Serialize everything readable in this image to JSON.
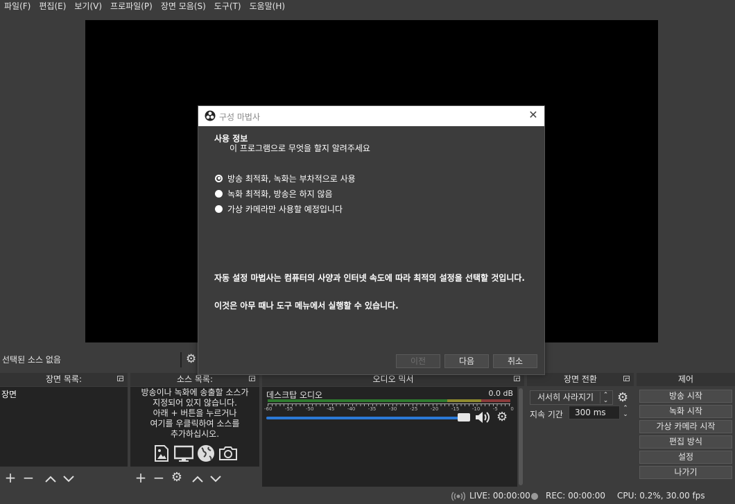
{
  "menubar": {
    "items": [
      "파일(F)",
      "편집(E)",
      "보기(V)",
      "프로파일(P)",
      "장면 모음(S)",
      "도구(T)",
      "도움말(H)"
    ]
  },
  "sourcebar": {
    "no_source": "선택된 소스 없음"
  },
  "scenes": {
    "title": "장면 목록:",
    "items": [
      "장면"
    ]
  },
  "sources": {
    "title": "소스 목록:",
    "hint": "방송이나 녹화에 송출할 소스가\n지정되어 있지 않습니다.\n아래 + 버튼을 누르거나\n여기를 우클릭하여 소스를\n추가하십시오."
  },
  "mixer": {
    "title": "오디오 믹서",
    "channel": "데스크탑 오디오",
    "db": "0.0 dB",
    "scale": [
      "-60",
      "-55",
      "-50",
      "-45",
      "-40",
      "-35",
      "-30",
      "-25",
      "-20",
      "-15",
      "-10",
      "-5",
      "0"
    ]
  },
  "transitions": {
    "title": "장면 전환",
    "selected": "서서히 사라지기",
    "duration_label": "지속 기간",
    "duration_value": "300 ms"
  },
  "controls": {
    "title": "제어",
    "buttons": [
      "방송 시작",
      "녹화 시작",
      "가상 카메라 시작",
      "편집 방식",
      "설정",
      "나가기"
    ]
  },
  "status": {
    "live": "LIVE: 00:00:00",
    "rec": "REC: 00:00:00",
    "cpu": "CPU: 0.2%, 30.00 fps"
  },
  "dialog": {
    "title": "구성 마법사",
    "heading": "사용 정보",
    "subheading": "이 프로그램으로 무엇을 할지 알려주세요",
    "options": [
      {
        "label": "방송 최적화, 녹화는 부차적으로 사용",
        "checked": true
      },
      {
        "label": "녹화 최적화, 방송은 하지 않음",
        "checked": false
      },
      {
        "label": "가상 카메라만 사용할 예정입니다",
        "checked": false
      }
    ],
    "description1": "자동 설정 마법사는 컴퓨터의 사양과 인터넷 속도에 따라 최적의 설정을 선택할 것입니다.",
    "description2": "이것은 아무 때나 도구 메뉴에서 실행할 수 있습니다.",
    "buttons": {
      "prev": "이전",
      "next": "다음",
      "cancel": "취소"
    }
  },
  "colors": {
    "accent": "#2b79d6",
    "background": "#3c3c3c",
    "panel": "#232323"
  }
}
